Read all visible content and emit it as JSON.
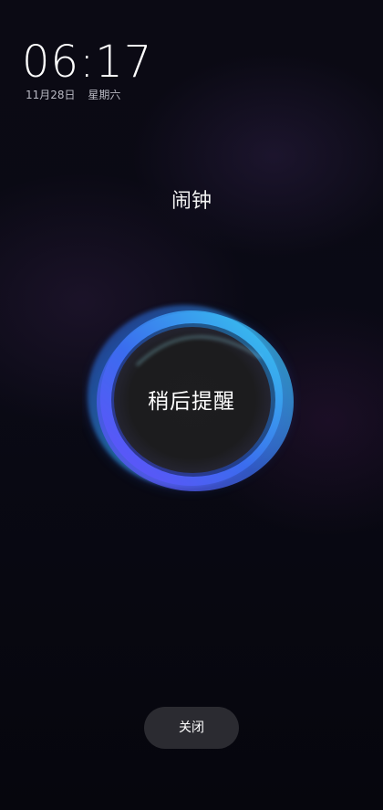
{
  "lockscreen": {
    "time": "06:17",
    "date": "11月28日",
    "weekday": "星期六"
  },
  "alarm": {
    "title": "闹钟",
    "snooze_label": "稍后提醒",
    "close_label": "关闭"
  },
  "colors": {
    "background": "#07070f",
    "orb_cyan": "#38d2f0",
    "orb_violet": "#6a4cff",
    "orb_center": "#1c1c1e",
    "close_button_bg": "#2b2b31"
  }
}
